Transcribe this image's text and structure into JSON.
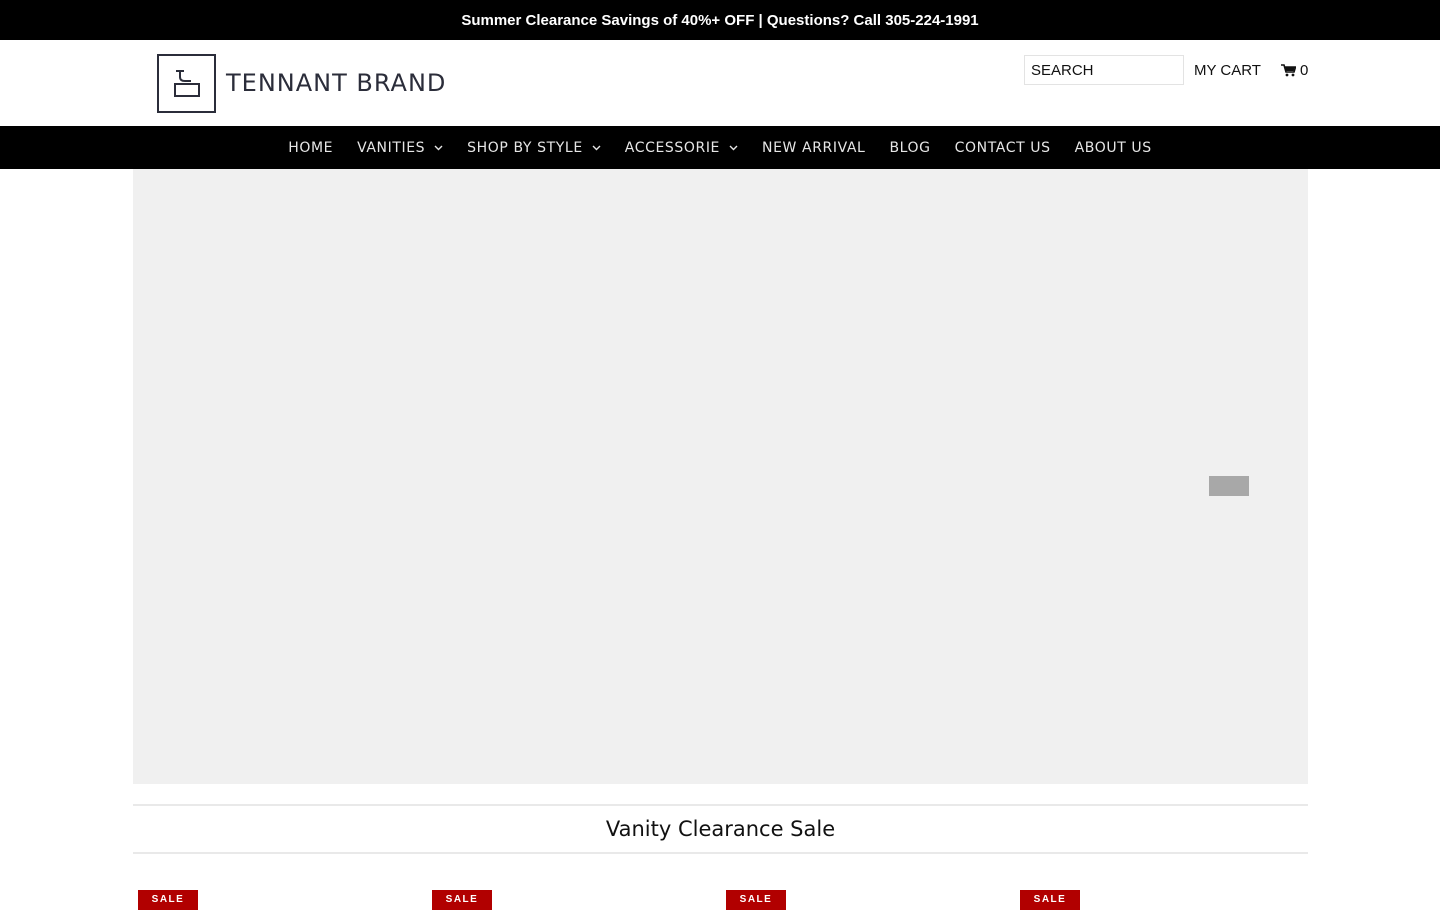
{
  "announcement": "Summer Clearance Savings of 40%+ OFF | Questions? Call 305-224-1991",
  "brand": {
    "name": "TENNANT BRAND"
  },
  "search": {
    "placeholder": "SEARCH"
  },
  "cart": {
    "label": "MY CART",
    "count": "0"
  },
  "nav": {
    "items": [
      {
        "label": "HOME",
        "dropdown": false
      },
      {
        "label": "VANITIES",
        "dropdown": true
      },
      {
        "label": "SHOP BY STYLE",
        "dropdown": true
      },
      {
        "label": "ACCESSORIE",
        "dropdown": true
      },
      {
        "label": "NEW ARRIVAL",
        "dropdown": false
      },
      {
        "label": "BLOG",
        "dropdown": false
      },
      {
        "label": "CONTACT US",
        "dropdown": false
      },
      {
        "label": "ABOUT US",
        "dropdown": false
      }
    ]
  },
  "section": {
    "title": "Vanity Clearance Sale"
  },
  "products": [
    {
      "badge": "SALE"
    },
    {
      "badge": "SALE"
    },
    {
      "badge": "SALE"
    },
    {
      "badge": "SALE"
    }
  ],
  "colors": {
    "announce_bg": "#000000",
    "nav_bg": "#000000",
    "hero_bg": "#f0f0f0",
    "sale_badge": "#b10000",
    "brand_ink": "#2b2d3a"
  }
}
